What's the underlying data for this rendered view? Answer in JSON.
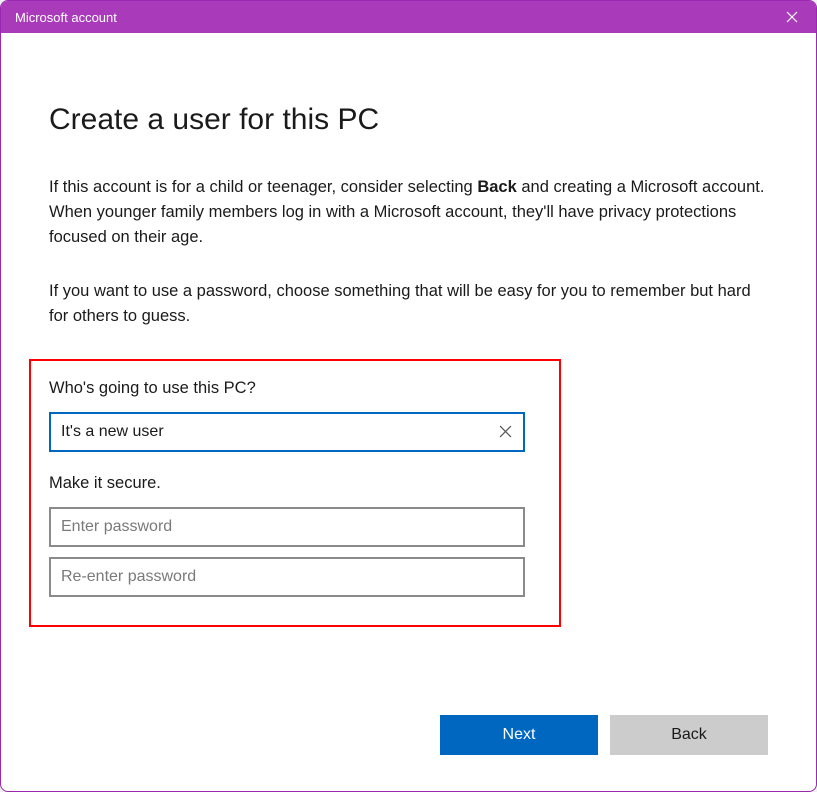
{
  "titlebar": {
    "title": "Microsoft account"
  },
  "main": {
    "heading": "Create a user for this PC",
    "description_pre_bold": "If this account is for a child or teenager, consider selecting ",
    "description_bold": "Back",
    "description_post_bold": " and creating a Microsoft account. When younger family members log in with a Microsoft account, they'll have privacy protections focused on their age.",
    "description2": "If you want to use a password, choose something that will be easy for you to remember but hard for others to guess."
  },
  "form": {
    "who_label": "Who's going to use this PC?",
    "username_value": "It's a new user",
    "secure_label": "Make it secure.",
    "password_placeholder": "Enter password",
    "reenter_password_placeholder": "Re-enter password"
  },
  "buttons": {
    "next": "Next",
    "back": "Back"
  },
  "colors": {
    "titlebar_bg": "#a93bbb",
    "primary_button": "#0067c0",
    "focus_border": "#0067c0",
    "highlight_box": "#ff0000"
  }
}
